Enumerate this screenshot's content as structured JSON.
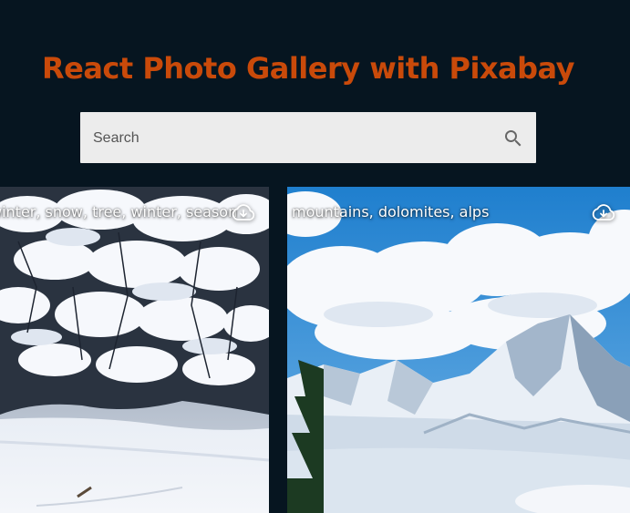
{
  "header": {
    "title": "React Photo Gallery with Pixabay"
  },
  "search": {
    "placeholder": "Search",
    "value": ""
  },
  "gallery": {
    "images": [
      {
        "tags": "winter, snow, tree, winter, season",
        "icon": "cloud-download-icon"
      },
      {
        "tags": "mountains, dolomites, alps",
        "icon": "cloud-download-icon"
      }
    ]
  }
}
